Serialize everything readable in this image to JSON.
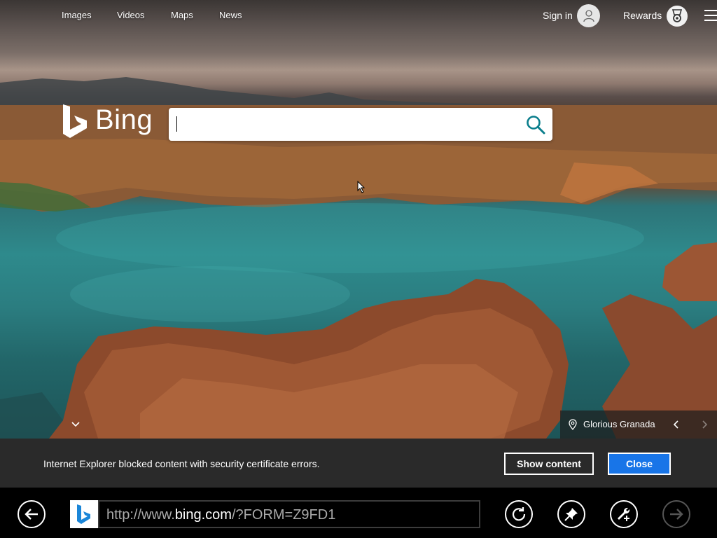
{
  "nav": {
    "links": [
      "Images",
      "Videos",
      "Maps",
      "News"
    ],
    "sign_in": "Sign in",
    "rewards": "Rewards"
  },
  "logo": {
    "text": "Bing"
  },
  "search": {
    "value": "",
    "placeholder": ""
  },
  "image_caption": {
    "location": "Glorious Granada"
  },
  "notification": {
    "message": "Internet Explorer blocked content with security certificate errors.",
    "show_content_label": "Show content",
    "close_label": "Close"
  },
  "address_bar": {
    "url_prefix": "http://www.",
    "url_domain": "bing.com",
    "url_suffix": "/?FORM=Z9FD1"
  },
  "colors": {
    "accent_blue": "#1875e8",
    "bing_teal": "#0a7e8c",
    "notif_bg": "#2a2a2a"
  },
  "icons": [
    "user-icon",
    "rewards-medal-icon",
    "hamburger-menu-icon",
    "search-icon",
    "chevron-down-icon",
    "location-pin-icon",
    "chevron-left-icon",
    "chevron-right-icon",
    "back-arrow-icon",
    "bing-favicon-icon",
    "refresh-icon",
    "pin-icon",
    "tools-wrench-icon",
    "forward-arrow-icon"
  ]
}
